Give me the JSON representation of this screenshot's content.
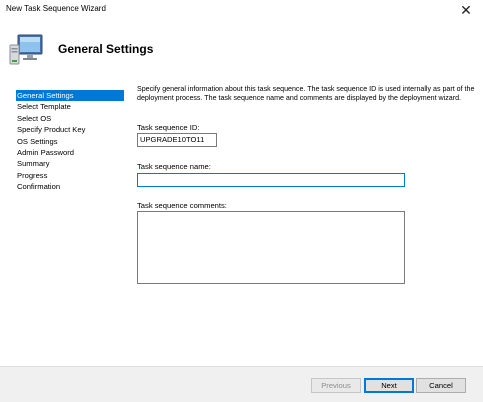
{
  "window": {
    "title": "New Task Sequence Wizard",
    "close_glyph": "✕"
  },
  "header": {
    "title": "General Settings",
    "icon": "computer-monitor-icon"
  },
  "nav": {
    "items": [
      {
        "label": "General Settings",
        "active": true
      },
      {
        "label": "Select Template"
      },
      {
        "label": "Select OS"
      },
      {
        "label": "Specify Product Key"
      },
      {
        "label": "OS Settings"
      },
      {
        "label": "Admin Password"
      },
      {
        "label": "Summary"
      },
      {
        "label": "Progress"
      },
      {
        "label": "Confirmation"
      }
    ]
  },
  "content": {
    "description": "Specify general information about this task sequence.  The task sequence ID is used internally as part of the deployment process.  The task sequence name and comments are displayed by the deployment wizard.",
    "id_label": "Task sequence ID:",
    "id_value": "UPGRADE10TO11",
    "name_label": "Task sequence name:",
    "name_value": "",
    "comments_label": "Task sequence comments:",
    "comments_value": ""
  },
  "footer": {
    "previous": "Previous",
    "next": "Next",
    "cancel": "Cancel"
  },
  "colors": {
    "selection": "#0078d7",
    "footer_bg": "#f0f0f0"
  }
}
